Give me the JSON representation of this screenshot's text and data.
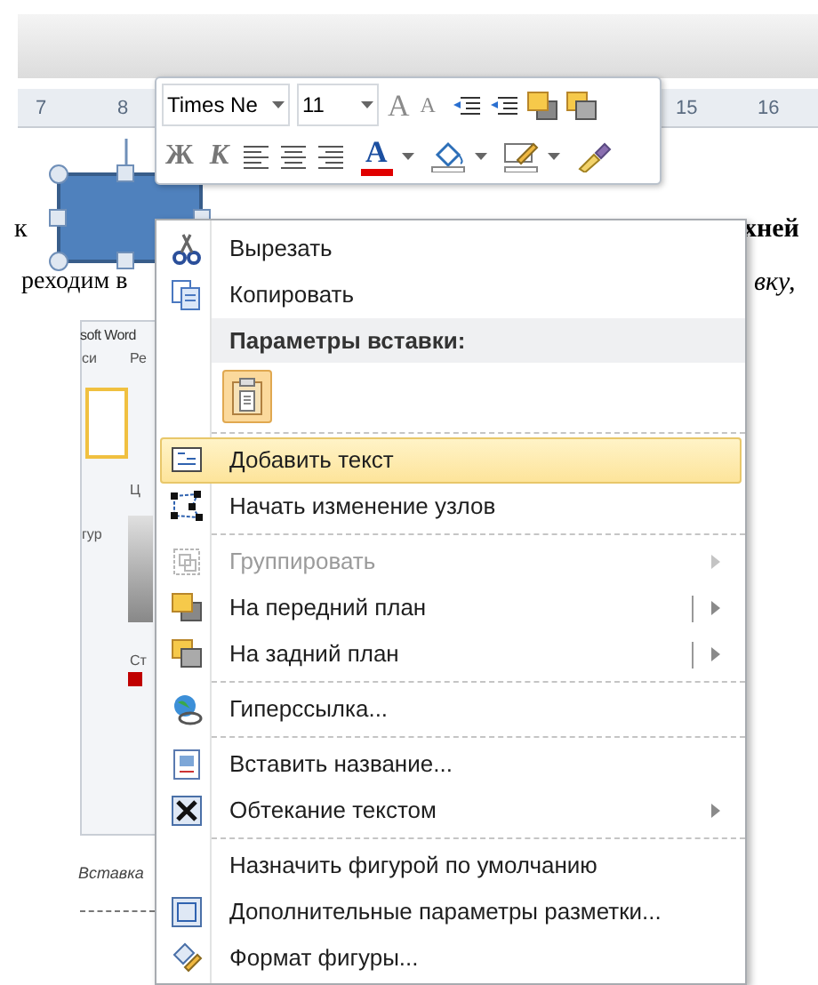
{
  "ruler": {
    "labels": [
      "7",
      "8",
      "15",
      "16"
    ]
  },
  "document": {
    "fragments": [
      "к",
      "хней",
      "реходим в",
      "вку,"
    ],
    "screenshot": {
      "title": "soft Word",
      "texts": [
        "си",
        "Ре",
        "Ц",
        "гур",
        "Ст"
      ],
      "caption": "Вставка"
    }
  },
  "mini_toolbar": {
    "font": "Times Ne",
    "size": "11",
    "grow": "A",
    "shrink": "A",
    "bold": "Ж",
    "italic": "К",
    "font_color": "A"
  },
  "menu": [
    {
      "kind": "item",
      "label": "Вырезать",
      "disabled": false,
      "selected": false,
      "submenu": false,
      "split": false
    },
    {
      "kind": "item",
      "label": "Копировать",
      "disabled": false,
      "selected": false,
      "submenu": false,
      "split": false
    },
    {
      "kind": "header",
      "label": "Параметры вставки:"
    },
    {
      "kind": "paste_options"
    },
    {
      "kind": "separator"
    },
    {
      "kind": "item",
      "label": "Добавить текст",
      "disabled": false,
      "selected": true,
      "submenu": false,
      "split": false
    },
    {
      "kind": "item",
      "label": "Начать изменение узлов",
      "disabled": false,
      "selected": false,
      "submenu": false,
      "split": false
    },
    {
      "kind": "separator"
    },
    {
      "kind": "item",
      "label": "Группировать",
      "disabled": true,
      "selected": false,
      "submenu": true,
      "split": false
    },
    {
      "kind": "item",
      "label": "На передний план",
      "disabled": false,
      "selected": false,
      "submenu": true,
      "split": true
    },
    {
      "kind": "item",
      "label": "На задний план",
      "disabled": false,
      "selected": false,
      "submenu": true,
      "split": true
    },
    {
      "kind": "separator"
    },
    {
      "kind": "item",
      "label": "Гиперссылка...",
      "disabled": false,
      "selected": false,
      "submenu": false,
      "split": false
    },
    {
      "kind": "separator"
    },
    {
      "kind": "item",
      "label": "Вставить название...",
      "disabled": false,
      "selected": false,
      "submenu": false,
      "split": false
    },
    {
      "kind": "item",
      "label": "Обтекание текстом",
      "disabled": false,
      "selected": false,
      "submenu": true,
      "split": false
    },
    {
      "kind": "separator"
    },
    {
      "kind": "item",
      "label": "Назначить фигурой по умолчанию",
      "disabled": false,
      "selected": false,
      "submenu": false,
      "split": false
    },
    {
      "kind": "item",
      "label": "Дополнительные параметры разметки...",
      "disabled": false,
      "selected": false,
      "submenu": false,
      "split": false
    },
    {
      "kind": "item",
      "label": "Формат фигуры...",
      "disabled": false,
      "selected": false,
      "submenu": false,
      "split": false
    }
  ]
}
